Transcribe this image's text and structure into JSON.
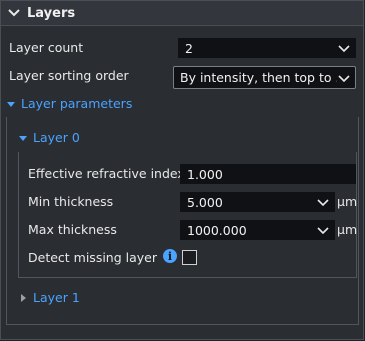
{
  "panel": {
    "title": "Layers"
  },
  "fields": {
    "layer_count": {
      "label": "Layer count",
      "value": "2"
    },
    "sorting": {
      "label": "Layer sorting order",
      "value": "By intensity, then top to ..."
    }
  },
  "layer_parameters": {
    "title": "Layer parameters",
    "layer0": {
      "title": "Layer 0",
      "effective_ri": {
        "label": "Effective refractive index",
        "value": "1.000"
      },
      "min_thickness": {
        "label": "Min thickness",
        "value": "5.000",
        "unit": "µm"
      },
      "max_thickness": {
        "label": "Max thickness",
        "value": "1000.000",
        "unit": "µm"
      },
      "detect_missing": {
        "label": "Detect missing layer",
        "info_icon": "i",
        "checked": false
      }
    },
    "layer1": {
      "title": "Layer 1"
    }
  },
  "colors": {
    "accent": "#4aa3ff",
    "panel_bg": "#2a2d32",
    "field_bg": "#0f1114"
  }
}
